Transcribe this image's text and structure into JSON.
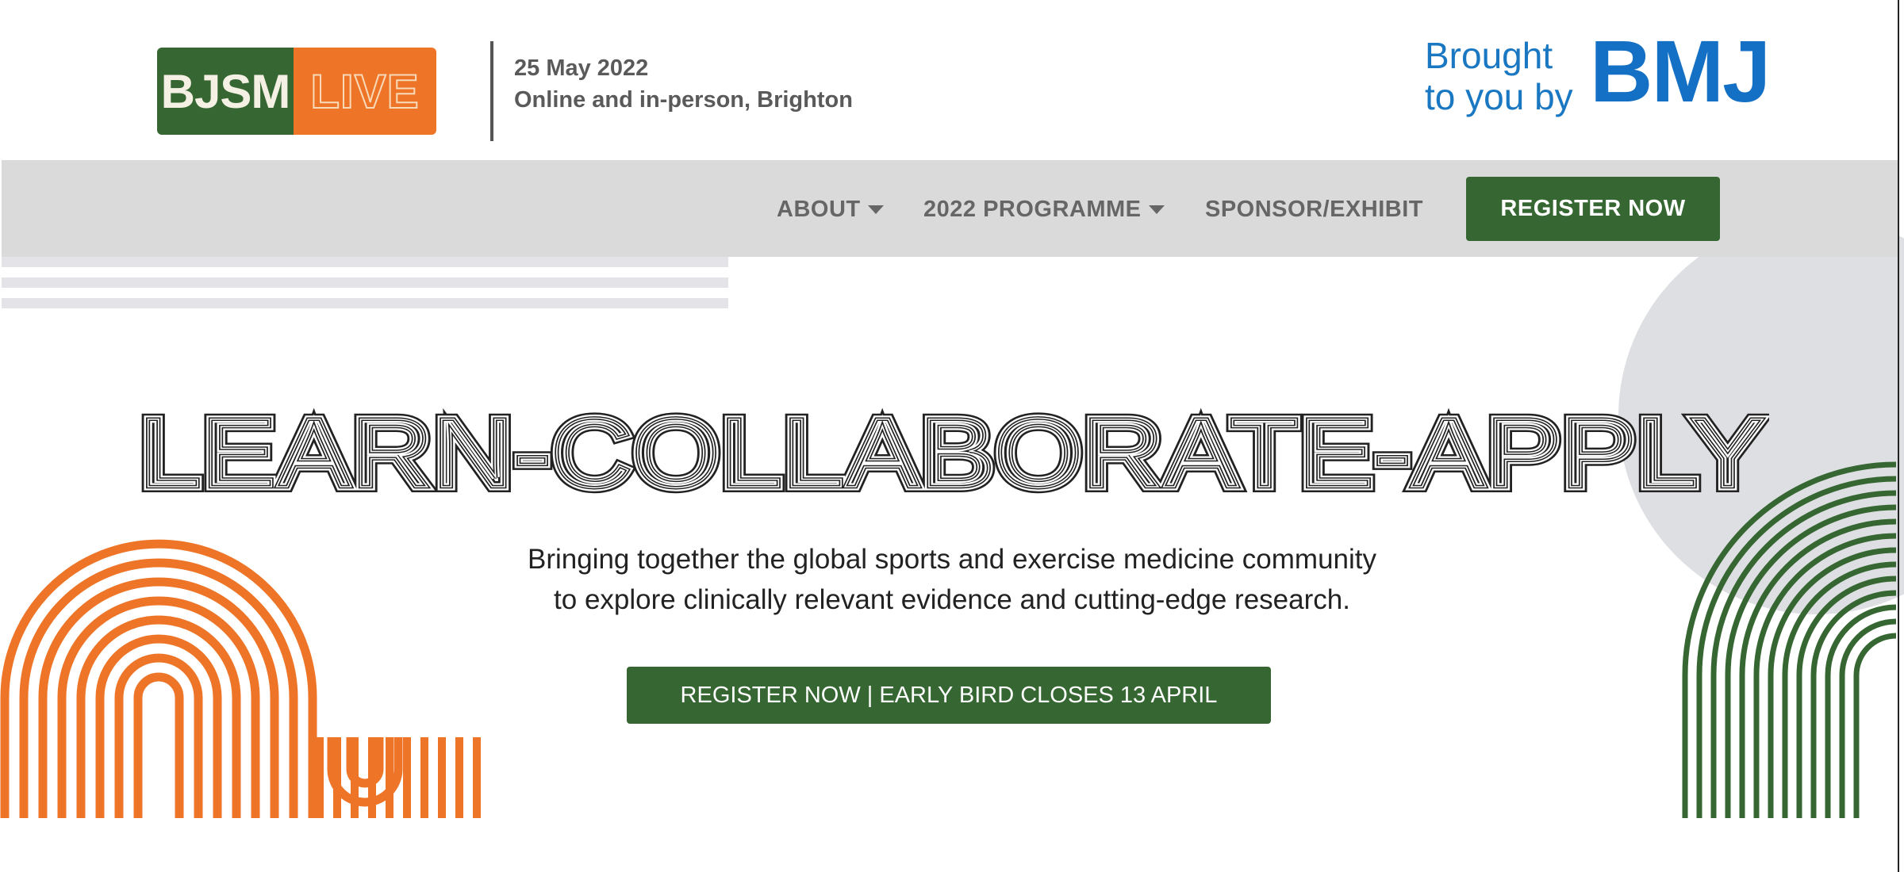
{
  "header": {
    "logo_left_text": "BJSM",
    "logo_right_text": "LIVE",
    "event_date": "25 May 2022",
    "event_location": "Online and in-person, Brighton",
    "brought_to_you_by_line1": "Brought",
    "brought_to_you_by_line2": "to you by",
    "bmj_logo_text": "BMJ"
  },
  "nav": {
    "items": [
      {
        "label": "ABOUT"
      },
      {
        "label": "2022 PROGRAMME"
      },
      {
        "label": "SPONSOR/EXHIBIT"
      }
    ],
    "register_label": "REGISTER NOW"
  },
  "hero": {
    "title": "LEARN-COLLABORATE-APPLY",
    "tagline_line1": "Bringing together the global sports and exercise medicine community",
    "tagline_line2": "to explore clinically relevant evidence and cutting-edge research.",
    "cta_label": "REGISTER NOW | EARLY BIRD CLOSES 13 APRIL"
  },
  "colors": {
    "brand_green": "#366732",
    "brand_orange": "#ee7528",
    "bmj_blue": "#1470c4",
    "nav_bg": "#dadada"
  },
  "icons": {
    "dropdown": "caret-down-icon"
  }
}
